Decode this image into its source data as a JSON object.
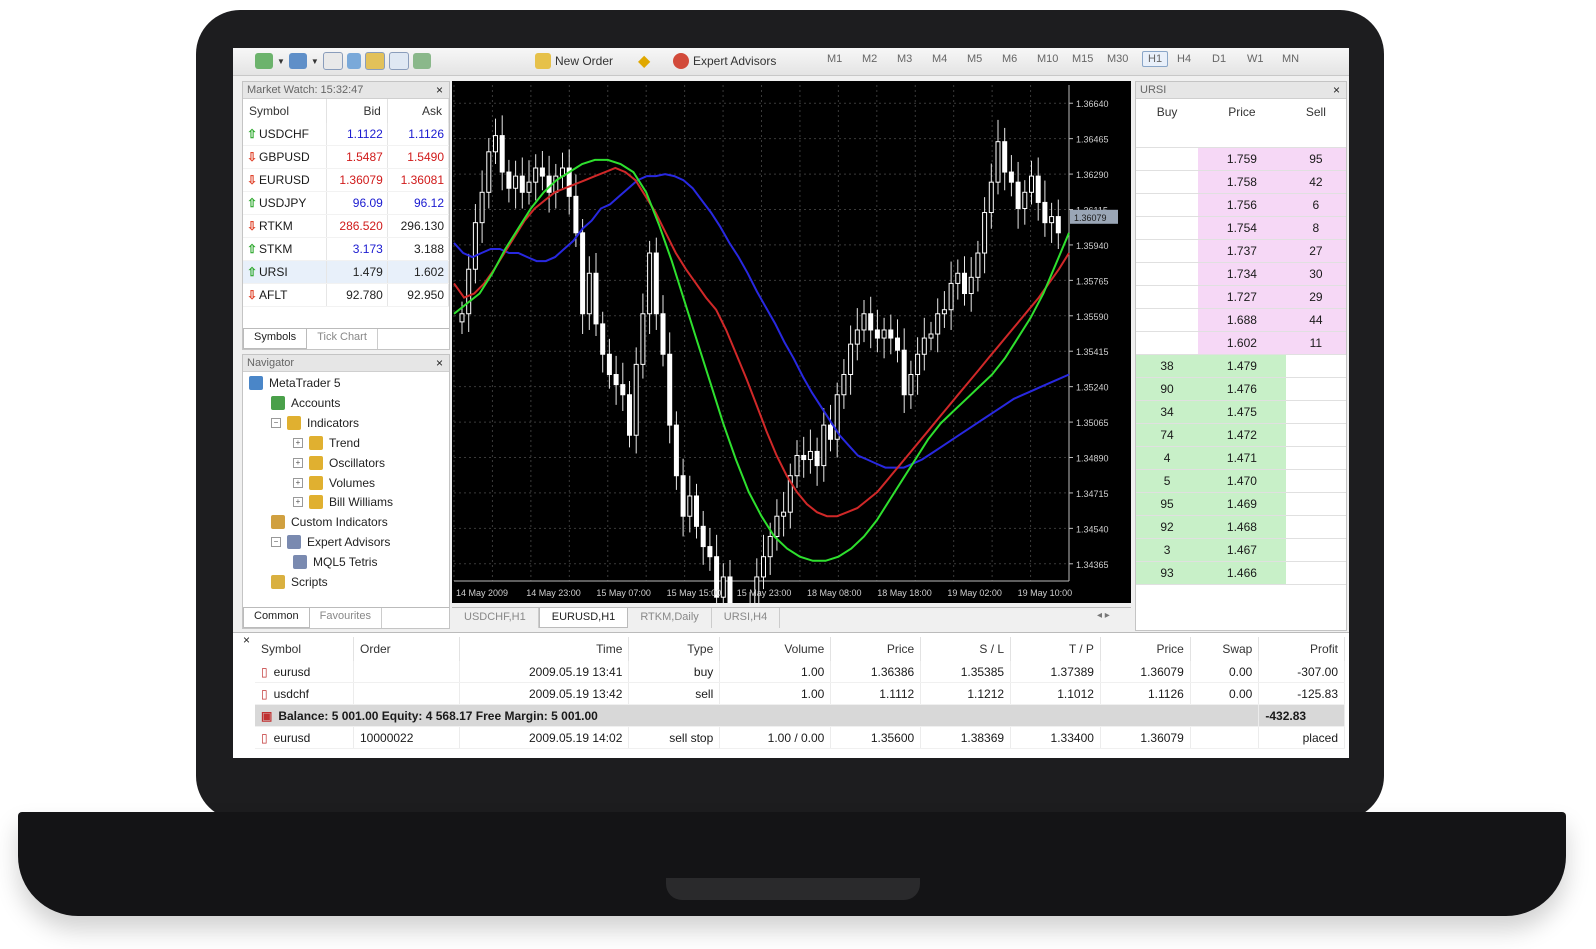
{
  "toolbar": {
    "new_order": "New Order",
    "expert_advisors": "Expert Advisors",
    "timeframes": [
      "M1",
      "M2",
      "M3",
      "M4",
      "M5",
      "M6",
      "M10",
      "M15",
      "M30",
      "H1",
      "H4",
      "D1",
      "W1",
      "MN"
    ],
    "selected_timeframe": "H1"
  },
  "market_watch": {
    "title": "Market Watch: 15:32:47",
    "columns": [
      "Symbol",
      "Bid",
      "Ask"
    ],
    "rows": [
      {
        "symbol": "USDCHF",
        "bid": "1.1122",
        "ask": "1.1126",
        "dir": "up",
        "bid_color": "#1a1ad0",
        "ask_color": "#1a1ad0"
      },
      {
        "symbol": "GBPUSD",
        "bid": "1.5487",
        "ask": "1.5490",
        "dir": "down",
        "bid_color": "#d01a1a",
        "ask_color": "#d01a1a"
      },
      {
        "symbol": "EURUSD",
        "bid": "1.36079",
        "ask": "1.36081",
        "dir": "down",
        "bid_color": "#d01a1a",
        "ask_color": "#d01a1a"
      },
      {
        "symbol": "USDJPY",
        "bid": "96.09",
        "ask": "96.12",
        "dir": "up",
        "bid_color": "#1a1ad0",
        "ask_color": "#1a1ad0"
      },
      {
        "symbol": "RTKM",
        "bid": "286.520",
        "ask": "296.130",
        "dir": "down",
        "bid_color": "#d01a1a",
        "ask_color": "#222222"
      },
      {
        "symbol": "STKM",
        "bid": "3.173",
        "ask": "3.188",
        "dir": "up",
        "bid_color": "#1a1ad0",
        "ask_color": "#222222"
      },
      {
        "symbol": "URSI",
        "bid": "1.479",
        "ask": "1.602",
        "dir": "up",
        "bid_color": "#222222",
        "ask_color": "#222222"
      },
      {
        "symbol": "AFLT",
        "bid": "92.780",
        "ask": "92.950",
        "dir": "down",
        "bid_color": "#222222",
        "ask_color": "#222222"
      }
    ],
    "tabs": [
      "Symbols",
      "Tick Chart"
    ]
  },
  "navigator": {
    "title": "Navigator",
    "items": [
      {
        "label": "MetaTrader 5",
        "level": 0
      },
      {
        "label": "Accounts",
        "level": 1
      },
      {
        "label": "Indicators",
        "level": 1
      },
      {
        "label": "Trend",
        "level": 2
      },
      {
        "label": "Oscillators",
        "level": 2
      },
      {
        "label": "Volumes",
        "level": 2
      },
      {
        "label": "Bill Williams",
        "level": 2
      },
      {
        "label": "Custom Indicators",
        "level": 1
      },
      {
        "label": "Expert Advisors",
        "level": 1
      },
      {
        "label": "MQL5 Tetris",
        "level": 2
      },
      {
        "label": "Scripts",
        "level": 1
      }
    ],
    "tabs": [
      "Common",
      "Favourites"
    ]
  },
  "chart": {
    "price_ticks": [
      "1.36640",
      "1.36465",
      "1.36290",
      "1.36115",
      "1.35940",
      "1.35765",
      "1.35590",
      "1.35415",
      "1.35240",
      "1.35065",
      "1.34890",
      "1.34715",
      "1.34540",
      "1.34365"
    ],
    "current_price": "1.36079",
    "time_ticks": [
      "14 May 2009",
      "14 May 23:00",
      "15 May 07:00",
      "15 May 15:00",
      "15 May 23:00",
      "18 May 08:00",
      "18 May 18:00",
      "19 May 02:00",
      "19 May 10:00"
    ],
    "tabs": [
      "USDCHF,H1",
      "EURUSD,H1",
      "RTKM,Daily",
      "URSI,H4"
    ],
    "active_tab": "EURUSD,H1"
  },
  "chart_data": {
    "type": "line",
    "ylim": [
      1.3428,
      1.3673
    ],
    "x": [
      0,
      1,
      2,
      3,
      4,
      5,
      6,
      7,
      8,
      9,
      10,
      11,
      12,
      13,
      14,
      15,
      16,
      17,
      18,
      19,
      20,
      21,
      22,
      23,
      24,
      25,
      26,
      27,
      28,
      29,
      30,
      31,
      32,
      33,
      34,
      35,
      36,
      37,
      38,
      39,
      40,
      41,
      42,
      43,
      44,
      45,
      46,
      47,
      48,
      49,
      50,
      51,
      52,
      53,
      54,
      55,
      56,
      57,
      58,
      59,
      60,
      61,
      62,
      63,
      64,
      65,
      66,
      67,
      68,
      69,
      70,
      71,
      72,
      73,
      74,
      75,
      76,
      77,
      78,
      79,
      80,
      81,
      82,
      83,
      84,
      85,
      86,
      87,
      88,
      89,
      90,
      91,
      92,
      93,
      94,
      95,
      96,
      97,
      98,
      99
    ],
    "series": [
      {
        "style": "candles",
        "color": "#ffffff",
        "close": [
          1.356,
          1.3582,
          1.3605,
          1.362,
          1.364,
          1.3648,
          1.363,
          1.3622,
          1.3628,
          1.362,
          1.3625,
          1.3632,
          1.3628,
          1.362,
          1.3628,
          1.3632,
          1.3618,
          1.36,
          1.356,
          1.358,
          1.3555,
          1.354,
          1.353,
          1.3525,
          1.352,
          1.35,
          1.3535,
          1.356,
          1.359,
          1.356,
          1.354,
          1.3505,
          1.348,
          1.346,
          1.347,
          1.3455,
          1.3445,
          1.344,
          1.342,
          1.343,
          1.3405,
          1.3392,
          1.34,
          1.3415,
          1.343,
          1.344,
          1.345,
          1.346,
          1.3462,
          1.348,
          1.349,
          1.3488,
          1.3492,
          1.3485,
          1.3505,
          1.3498,
          1.352,
          1.353,
          1.3545,
          1.3552,
          1.356,
          1.3552,
          1.3548,
          1.3552,
          1.3548,
          1.3542,
          1.352,
          1.353,
          1.354,
          1.3548,
          1.355,
          1.356,
          1.3562,
          1.3575,
          1.358,
          1.357,
          1.3578,
          1.359,
          1.361,
          1.3625,
          1.3645,
          1.363,
          1.3625,
          1.3612,
          1.362,
          1.3628,
          1.3615,
          1.3605,
          1.3608,
          1.36
        ]
      },
      {
        "style": "line",
        "color": "#2828e0",
        "values": [
          1.3595,
          1.359,
          1.3588,
          1.359,
          1.3592,
          1.3592,
          1.359,
          1.359,
          1.3588,
          1.3586,
          1.3586,
          1.3588,
          1.3592,
          1.3596,
          1.3602,
          1.3606,
          1.3612,
          1.3614,
          1.3618,
          1.3622,
          1.3626,
          1.3628,
          1.3628,
          1.3629,
          1.3628,
          1.3626,
          1.3622,
          1.3616,
          1.361,
          1.3603,
          1.3595,
          1.3588,
          1.358,
          1.3571,
          1.3563,
          1.3555,
          1.3546,
          1.3538,
          1.3529,
          1.3521,
          1.3514,
          1.3507,
          1.35,
          1.3495,
          1.349,
          1.3488,
          1.3486,
          1.3484,
          1.3484,
          1.3484,
          1.3486,
          1.3488,
          1.3491,
          1.3494,
          1.3497,
          1.35,
          1.3503,
          1.3506,
          1.3509,
          1.3512,
          1.3515,
          1.3518,
          1.352,
          1.3522,
          1.3524,
          1.3526,
          1.3528,
          1.353
        ]
      },
      {
        "style": "line",
        "color": "#d02828",
        "values": [
          1.3575,
          1.3568,
          1.357,
          1.3575,
          1.3582,
          1.359,
          1.3598,
          1.3606,
          1.3612,
          1.3616,
          1.362,
          1.3622,
          1.3624,
          1.3626,
          1.3628,
          1.363,
          1.3632,
          1.363,
          1.3626,
          1.3618,
          1.361,
          1.36,
          1.359,
          1.3582,
          1.3575,
          1.3568,
          1.3562,
          1.3552,
          1.354,
          1.3528,
          1.3515,
          1.3502,
          1.349,
          1.348,
          1.3472,
          1.3466,
          1.3462,
          1.346,
          1.346,
          1.3462,
          1.3464,
          1.3468,
          1.3472,
          1.3478,
          1.3484,
          1.349,
          1.3496,
          1.3502,
          1.3508,
          1.3514,
          1.352,
          1.3526,
          1.3532,
          1.3538,
          1.3544,
          1.355,
          1.3556,
          1.3562,
          1.3568,
          1.3575,
          1.3582,
          1.359
        ]
      },
      {
        "style": "line",
        "color": "#2ee02e",
        "values": [
          1.356,
          1.3565,
          1.357,
          1.358,
          1.3592,
          1.3602,
          1.3612,
          1.362,
          1.3626,
          1.363,
          1.3634,
          1.3636,
          1.3636,
          1.3634,
          1.363,
          1.362,
          1.3604,
          1.3586,
          1.3566,
          1.3546,
          1.3526,
          1.3506,
          1.3488,
          1.3472,
          1.346,
          1.345,
          1.3444,
          1.344,
          1.3438,
          1.3438,
          1.344,
          1.3444,
          1.345,
          1.3458,
          1.3468,
          1.3478,
          1.3488,
          1.3498,
          1.3506,
          1.3512,
          1.3518,
          1.3524,
          1.353,
          1.3538,
          1.3548,
          1.3558,
          1.357,
          1.3585,
          1.36
        ]
      }
    ]
  },
  "dom": {
    "title": "URSI",
    "columns": [
      "Buy",
      "Price",
      "Sell"
    ],
    "sell_rows": [
      {
        "price": "1.759",
        "sell": "95"
      },
      {
        "price": "1.758",
        "sell": "42"
      },
      {
        "price": "1.756",
        "sell": "6"
      },
      {
        "price": "1.754",
        "sell": "8"
      },
      {
        "price": "1.737",
        "sell": "27"
      },
      {
        "price": "1.734",
        "sell": "30"
      },
      {
        "price": "1.727",
        "sell": "29"
      },
      {
        "price": "1.688",
        "sell": "44"
      },
      {
        "price": "1.602",
        "sell": "11"
      }
    ],
    "buy_rows": [
      {
        "buy": "38",
        "price": "1.479"
      },
      {
        "buy": "90",
        "price": "1.476"
      },
      {
        "buy": "34",
        "price": "1.475"
      },
      {
        "buy": "74",
        "price": "1.472"
      },
      {
        "buy": "4",
        "price": "1.471"
      },
      {
        "buy": "5",
        "price": "1.470"
      },
      {
        "buy": "95",
        "price": "1.469"
      },
      {
        "buy": "92",
        "price": "1.468"
      },
      {
        "buy": "3",
        "price": "1.467"
      },
      {
        "buy": "93",
        "price": "1.466"
      }
    ],
    "sell_color": "#f6d8f6",
    "buy_color": "#c8f0c8"
  },
  "toolbox": {
    "columns": [
      "Symbol",
      "Order",
      "Time",
      "Type",
      "Volume",
      "Price",
      "S / L",
      "T / P",
      "Price",
      "Swap",
      "Profit"
    ],
    "rows": [
      [
        "eurusd",
        "",
        "2009.05.19 13:41",
        "buy",
        "1.00",
        "1.36386",
        "1.35385",
        "1.37389",
        "1.36079",
        "0.00",
        "-307.00"
      ],
      [
        "usdchf",
        "",
        "2009.05.19 13:42",
        "sell",
        "1.00",
        "1.1112",
        "1.1212",
        "1.1012",
        "1.1126",
        "0.00",
        "-125.83"
      ]
    ],
    "balance_line": "Balance: 5 001.00  Equity: 4 568.17  Free Margin: 5 001.00",
    "balance_profit": "-432.83",
    "pending_row": [
      "eurusd",
      "10000022",
      "2009.05.19 14:02",
      "sell stop",
      "1.00 / 0.00",
      "1.35600",
      "1.38369",
      "1.33400",
      "1.36079",
      "",
      "placed"
    ]
  }
}
